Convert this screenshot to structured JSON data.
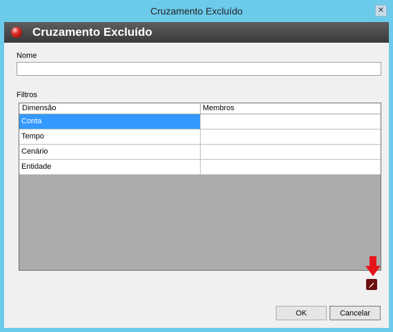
{
  "window": {
    "title": "Cruzamento Excluído",
    "close_symbol": "✕"
  },
  "header": {
    "title": "Cruzamento Excluído"
  },
  "form": {
    "name_label": "Nome",
    "name_value": "",
    "filters_label": "Filtros"
  },
  "grid": {
    "columns": [
      "Dimensão",
      "Membros"
    ],
    "rows": [
      {
        "dimension": "Conta",
        "members": "",
        "selected": true
      },
      {
        "dimension": "Tempo",
        "members": ""
      },
      {
        "dimension": "Cenário",
        "members": ""
      },
      {
        "dimension": "Entidade",
        "members": ""
      }
    ]
  },
  "buttons": {
    "ok": "OK",
    "cancel": "Cancelar"
  },
  "colors": {
    "title_bar": "#6ccbeb",
    "header_band": "#4a4a4a",
    "selection": "#3399ff",
    "arrow": "#e8141b",
    "edit_button": "#6b0f0f"
  },
  "icons": {
    "header": "red-orb-icon",
    "close": "close-icon",
    "edit": "pencil-icon",
    "pointer": "down-arrow-icon"
  }
}
